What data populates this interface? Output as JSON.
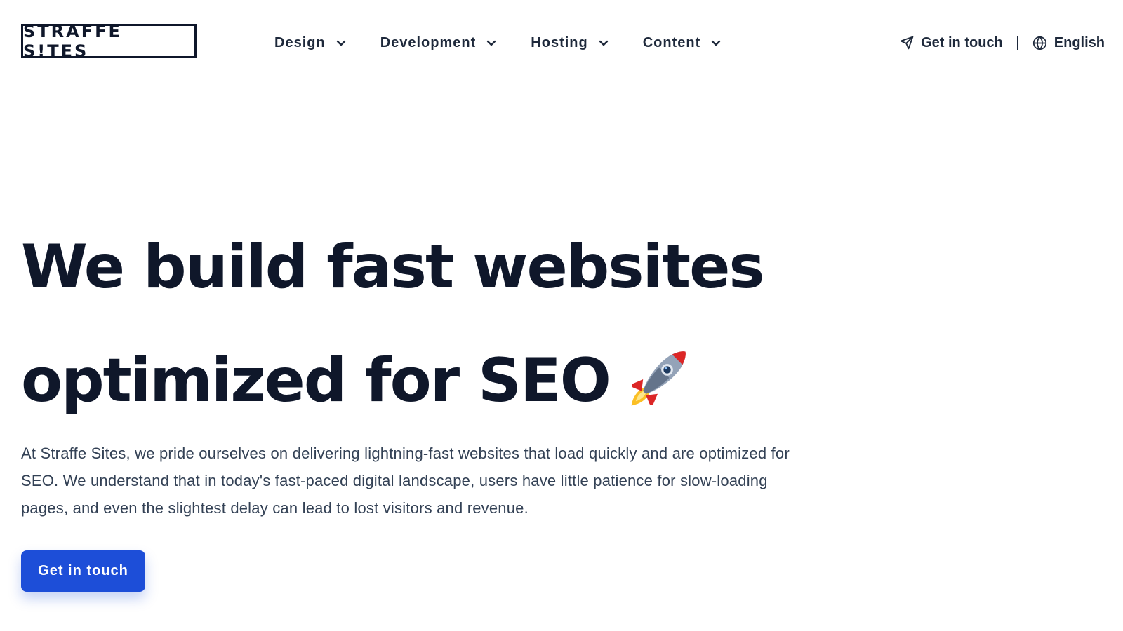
{
  "brand": {
    "logo_text": "STRAFFE S!TES"
  },
  "nav": {
    "items": [
      {
        "label": "Design",
        "icon": "chevron-down-icon"
      },
      {
        "label": "Development",
        "icon": "chevron-down-icon"
      },
      {
        "label": "Hosting",
        "icon": "chevron-down-icon"
      },
      {
        "label": "Content",
        "icon": "chevron-down-icon"
      }
    ]
  },
  "header_right": {
    "contact_label": "Get in touch",
    "contact_icon": "paper-plane-icon",
    "language_label": "English",
    "language_icon": "globe-icon"
  },
  "hero": {
    "title_line1": "We build fast websites",
    "title_line2": "optimized for SEO",
    "title_emoji": "rocket-icon",
    "description": "At Straffe Sites, we pride ourselves on delivering lightning-fast websites that load quickly and are optimized for SEO. We understand that in today's fast-paced digital landscape, users have little patience for slow-loading pages, and even the slightest delay can lead to lost visitors and revenue.",
    "cta_label": "Get in touch"
  },
  "colors": {
    "text_dark": "#0f172a",
    "body_text": "#334155",
    "accent_blue": "#1d4ed8",
    "background": "#ffffff"
  }
}
